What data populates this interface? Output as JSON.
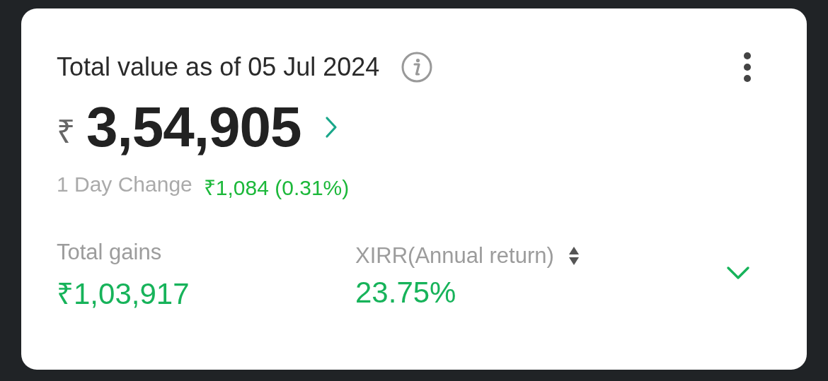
{
  "summary": {
    "title": "Total value as of 05 Jul 2024",
    "currency": "₹",
    "amount": "3,54,905",
    "day_change": {
      "label": "1 Day Change",
      "value": "₹1,084 (0.31%)"
    },
    "stats": [
      {
        "kind": "plain",
        "label": "Total gains",
        "value": "₹1,03,917"
      },
      {
        "kind": "sortable",
        "label": "XIRR(Annual return)",
        "value": "23.75%"
      }
    ],
    "expanded": false
  }
}
